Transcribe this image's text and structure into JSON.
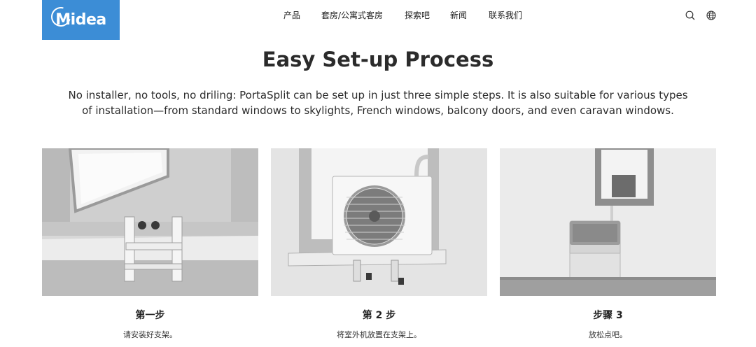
{
  "brand": {
    "logo_text": "Midea",
    "color": "#3c8dd6"
  },
  "nav": {
    "items": [
      {
        "label": "产品"
      },
      {
        "label": "套房/公寓式客房"
      },
      {
        "label": "探索吧"
      },
      {
        "label": "新闻"
      },
      {
        "label": "联系我们"
      }
    ],
    "icons": [
      "search-icon",
      "globe-icon"
    ]
  },
  "hero": {
    "title": "Easy Set-up Process",
    "intro": "No installer, no tools, no driling: PortaSplit can be set up in just three simple steps. It is also suitable for various types of installation—from standard windows to skylights, French windows, balcony doors, and even caravan windows."
  },
  "steps": [
    {
      "title": "第一步",
      "desc": "请安装好支架。"
    },
    {
      "title": "第 2 步",
      "desc": "将室外机放置在支架上。"
    },
    {
      "title": "步骤 3",
      "desc": "放松点吧。"
    }
  ]
}
